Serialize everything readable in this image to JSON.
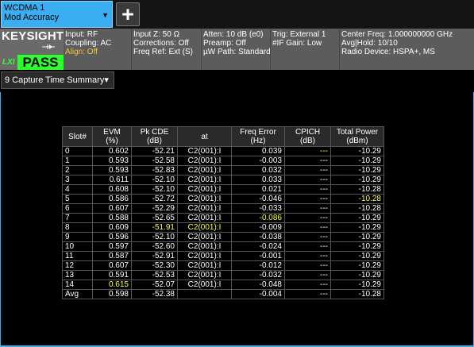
{
  "tab": {
    "line1": "WCDMA 1",
    "line2": "Mod Accuracy"
  },
  "add_tab_label": "+",
  "brand": {
    "logo": "KEYSIGHT",
    "lxi": "LXI",
    "status": "PASS"
  },
  "settings_cols": [
    [
      "Input: RF",
      "Coupling: AC",
      "Align: Off"
    ],
    [
      "Input Z: 50 Ω",
      "Corrections: Off",
      "Freq Ref: Ext (S)"
    ],
    [
      "Atten: 10 dB (e0)",
      "Preamp: Off",
      "µW Path: Standard"
    ],
    [
      "Trig: External 1",
      "#IF Gain: Low",
      ""
    ],
    [
      "Center Freq: 1.000000000 GHz",
      "Avg|Hold: 10/10",
      "Radio Device: HSPA+, MS"
    ]
  ],
  "view_menu": {
    "label": "9 Capture Time Summary",
    "chevron": "▾"
  },
  "colors": {
    "tab_blue": "#3aaef0",
    "pass_green": "#2bff2b",
    "warn": "#f3c63b",
    "highlight": "#ffff3a"
  },
  "table": {
    "headers": [
      [
        "Slot#"
      ],
      [
        "EVM",
        "(%)"
      ],
      [
        "Pk CDE",
        "(dB)"
      ],
      [
        "at"
      ],
      [
        "Freq Error",
        "(Hz)"
      ],
      [
        "CPICH",
        "(dB)"
      ],
      [
        "Total Power",
        "(dBm)"
      ]
    ],
    "rows": [
      [
        "0",
        "0.602",
        "-52.21",
        "C2(001):I",
        "0.039",
        "---",
        "-10.29"
      ],
      [
        "1",
        "0.593",
        "-52.58",
        "C2(001):I",
        "-0.003",
        "---",
        "-10.29"
      ],
      [
        "2",
        "0.593",
        "-52.83",
        "C2(001):I",
        "0.032",
        "---",
        "-10.29"
      ],
      [
        "3",
        "0.611",
        "-52.10",
        "C2(001):I",
        "0.033",
        "---",
        "-10.29"
      ],
      [
        "4",
        "0.608",
        "-52.10",
        "C2(001):I",
        "0.021",
        "---",
        "-10.28"
      ],
      [
        "5",
        "0.586",
        "-52.72",
        "C2(001):I",
        "-0.046",
        "---",
        "-10.28"
      ],
      [
        "6",
        "0.607",
        "-52.29",
        "C2(001):I",
        "-0.033",
        "---",
        "-10.28"
      ],
      [
        "7",
        "0.588",
        "-52.65",
        "C2(001):I",
        "-0.086",
        "---",
        "-10.29"
      ],
      [
        "8",
        "0.609",
        "-51.91",
        "C2(001):I",
        "-0.009",
        "---",
        "-10.29"
      ],
      [
        "9",
        "0.596",
        "-52.10",
        "C2(001):I",
        "-0.038",
        "---",
        "-10.29"
      ],
      [
        "10",
        "0.597",
        "-52.60",
        "C2(001):I",
        "-0.024",
        "---",
        "-10.29"
      ],
      [
        "11",
        "0.587",
        "-52.91",
        "C2(001):I",
        "-0.001",
        "---",
        "-10.29"
      ],
      [
        "12",
        "0.607",
        "-52.30",
        "C2(001):I",
        "-0.012",
        "---",
        "-10.29"
      ],
      [
        "13",
        "0.591",
        "-52.53",
        "C2(001):I",
        "-0.032",
        "---",
        "-10.29"
      ],
      [
        "14",
        "0.615",
        "-52.07",
        "C2(001):I",
        "-0.048",
        "---",
        "-10.29"
      ],
      [
        "Avg",
        "0.598",
        "-52.38",
        "",
        "-0.004",
        "---",
        "-10.28"
      ]
    ],
    "highlights": [
      {
        "row": 0,
        "col": 5
      },
      {
        "row": 5,
        "col": 6
      },
      {
        "row": 7,
        "col": 4
      },
      {
        "row": 8,
        "col": 2
      },
      {
        "row": 8,
        "col": 3
      },
      {
        "row": 14,
        "col": 1
      }
    ]
  }
}
